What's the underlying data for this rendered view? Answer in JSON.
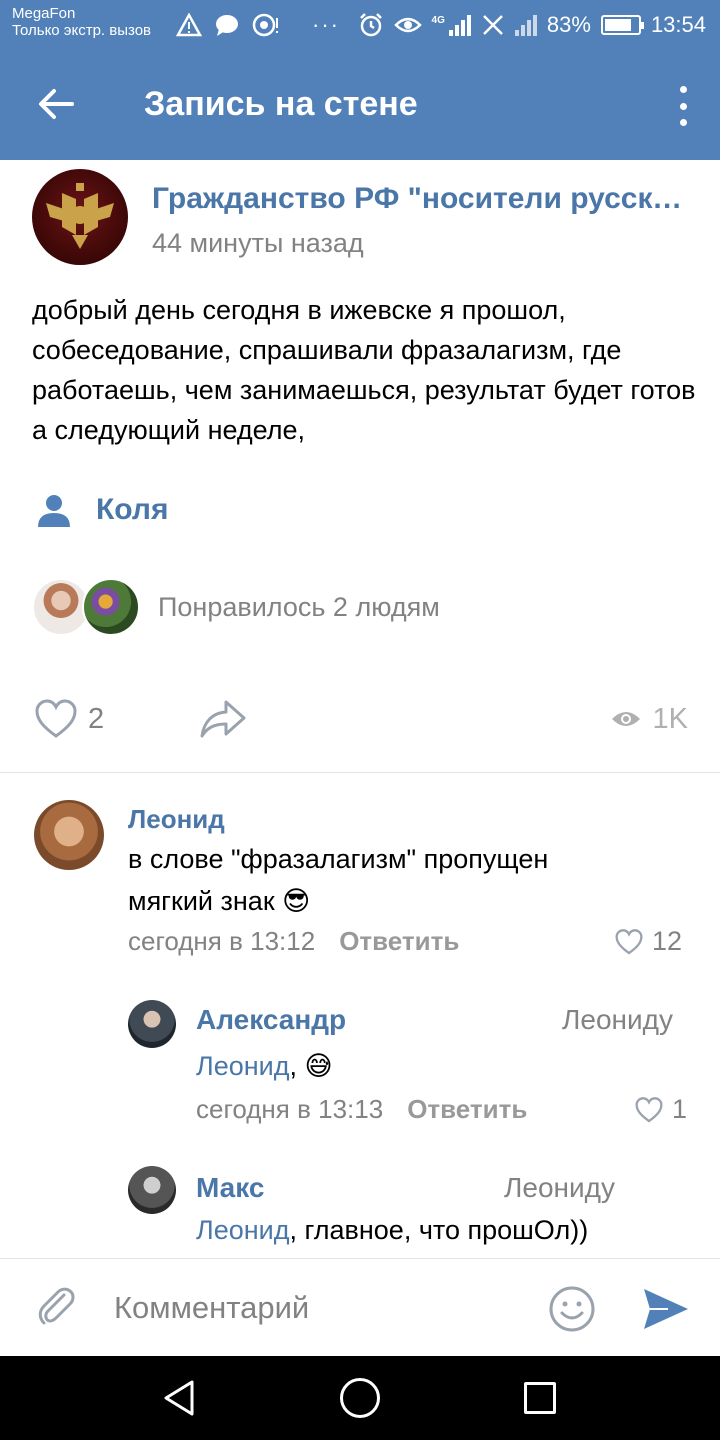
{
  "status_bar": {
    "carrier": "MegaFon",
    "carrier_sub": "Только экстр. вызов",
    "dots": "···",
    "network": "4G",
    "battery": "83%",
    "battery_level": 0.83,
    "time": "13:54"
  },
  "toolbar": {
    "title": "Запись на стене"
  },
  "post": {
    "group_name": "Гражданство РФ \"носители русского",
    "time": "44 минуты назад",
    "text": "добрый день сегодня в ижевске я прошол, собеседование, спрашивали фразалагизм, где работаешь, чем занимаешься, результат будет готов а следующий неделе,",
    "signer": "Коля",
    "liked_by": "Понравилось 2 людям",
    "likes": "2",
    "views": "1K"
  },
  "comments": [
    {
      "author": "Леонид",
      "text": "в слове \"фразалагизм\" пропущен мягкий знак",
      "emoji": "😎",
      "time": "сегодня в 13:12",
      "reply_label": "Ответить",
      "likes": "12"
    },
    {
      "author": "Александр",
      "reply_to": "Леониду",
      "mention": "Леонид",
      "text": ", ",
      "emoji": "😅",
      "time": "сегодня в 13:13",
      "reply_label": "Ответить",
      "likes": "1"
    },
    {
      "author": "Макс",
      "reply_to": "Леониду",
      "mention": "Леонид",
      "text": ", главное, что прошОл))"
    }
  ],
  "input": {
    "placeholder": "Комментарий"
  },
  "colors": {
    "header": "#5181b8",
    "link": "#4a76a8",
    "secondary": "#828282",
    "send": "#5181b8"
  }
}
